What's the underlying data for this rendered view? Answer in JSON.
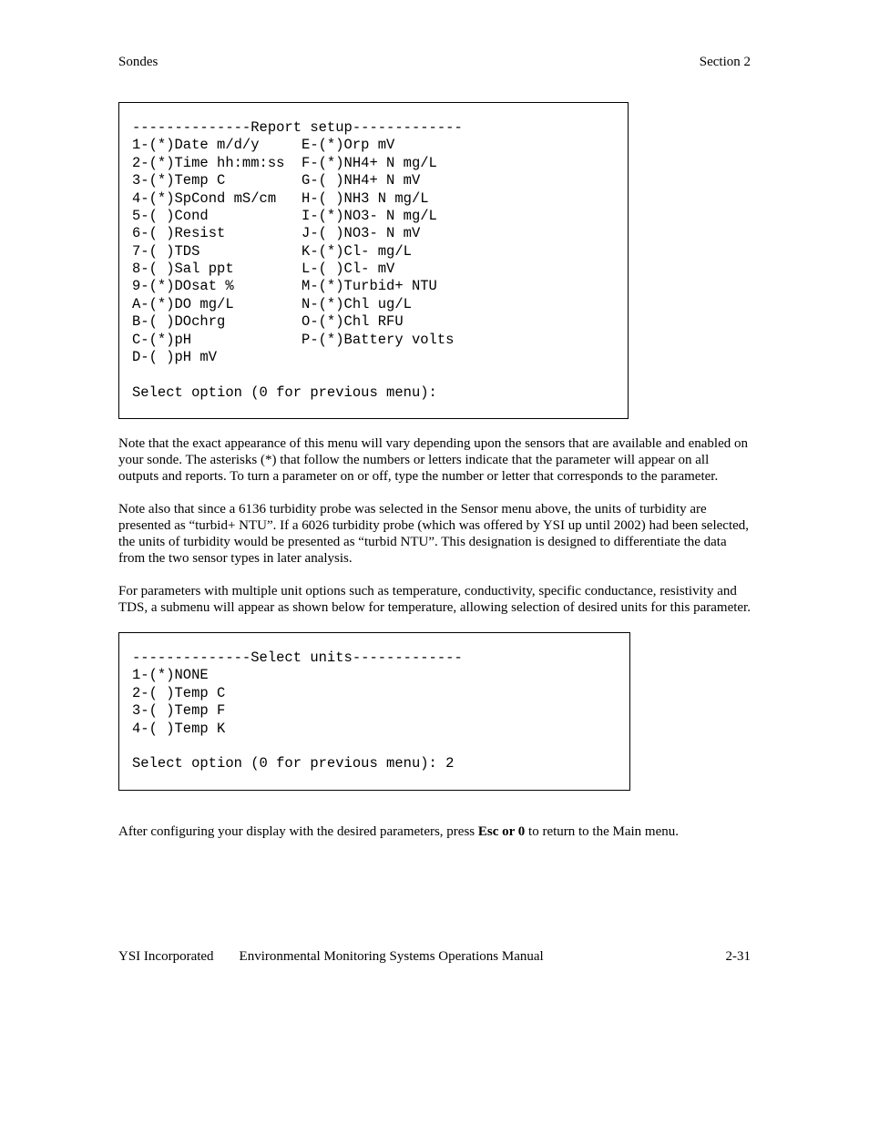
{
  "header": {
    "left": "Sondes",
    "right": "Section 2"
  },
  "menu1": "--------------Report setup-------------\n1-(*)Date m/d/y     E-(*)Orp mV\n2-(*)Time hh:mm:ss  F-(*)NH4+ N mg/L\n3-(*)Temp C         G-( )NH4+ N mV\n4-(*)SpCond mS/cm   H-( )NH3 N mg/L\n5-( )Cond           I-(*)NO3- N mg/L\n6-( )Resist         J-( )NO3- N mV\n7-( )TDS            K-(*)Cl- mg/L\n8-( )Sal ppt        L-( )Cl- mV\n9-(*)DOsat %        M-(*)Turbid+ NTU\nA-(*)DO mg/L        N-(*)Chl ug/L\nB-( )DOchrg         O-(*)Chl RFU\nC-(*)pH             P-(*)Battery volts\nD-( )pH mV\n\nSelect option (0 for previous menu):",
  "para1": "Note that the exact appearance of this menu will vary depending upon the sensors that are available and enabled on your sonde.  The asterisks (*) that follow the numbers or letters indicate that the parameter will appear on all outputs and reports.  To turn a parameter on or off, type the number or letter that corresponds to the parameter.",
  "para2": "Note also that since a 6136 turbidity probe was selected in the Sensor menu above, the units of turbidity are presented as “turbid+ NTU”.   If a 6026 turbidity probe (which was offered by YSI up until 2002)  had been selected, the units of turbidity would be presented as “turbid NTU”.  This designation is designed to differentiate the data from the two sensor types in later analysis.",
  "para3": "For parameters with multiple unit options such as temperature, conductivity, specific conductance, resistivity and TDS, a submenu will appear as shown below for temperature, allowing selection of desired units for this parameter.",
  "menu2": "--------------Select units-------------\n1-(*)NONE\n2-( )Temp C\n3-( )Temp F\n4-( )Temp K\n\nSelect option (0 for previous menu): 2",
  "para4_before": "After configuring your display with the desired parameters, press ",
  "para4_bold": "Esc or 0",
  "para4_after": " to return to the Main menu.",
  "footer": {
    "left": "YSI Incorporated",
    "center": "Environmental Monitoring Systems Operations Manual",
    "right": "2-31"
  }
}
